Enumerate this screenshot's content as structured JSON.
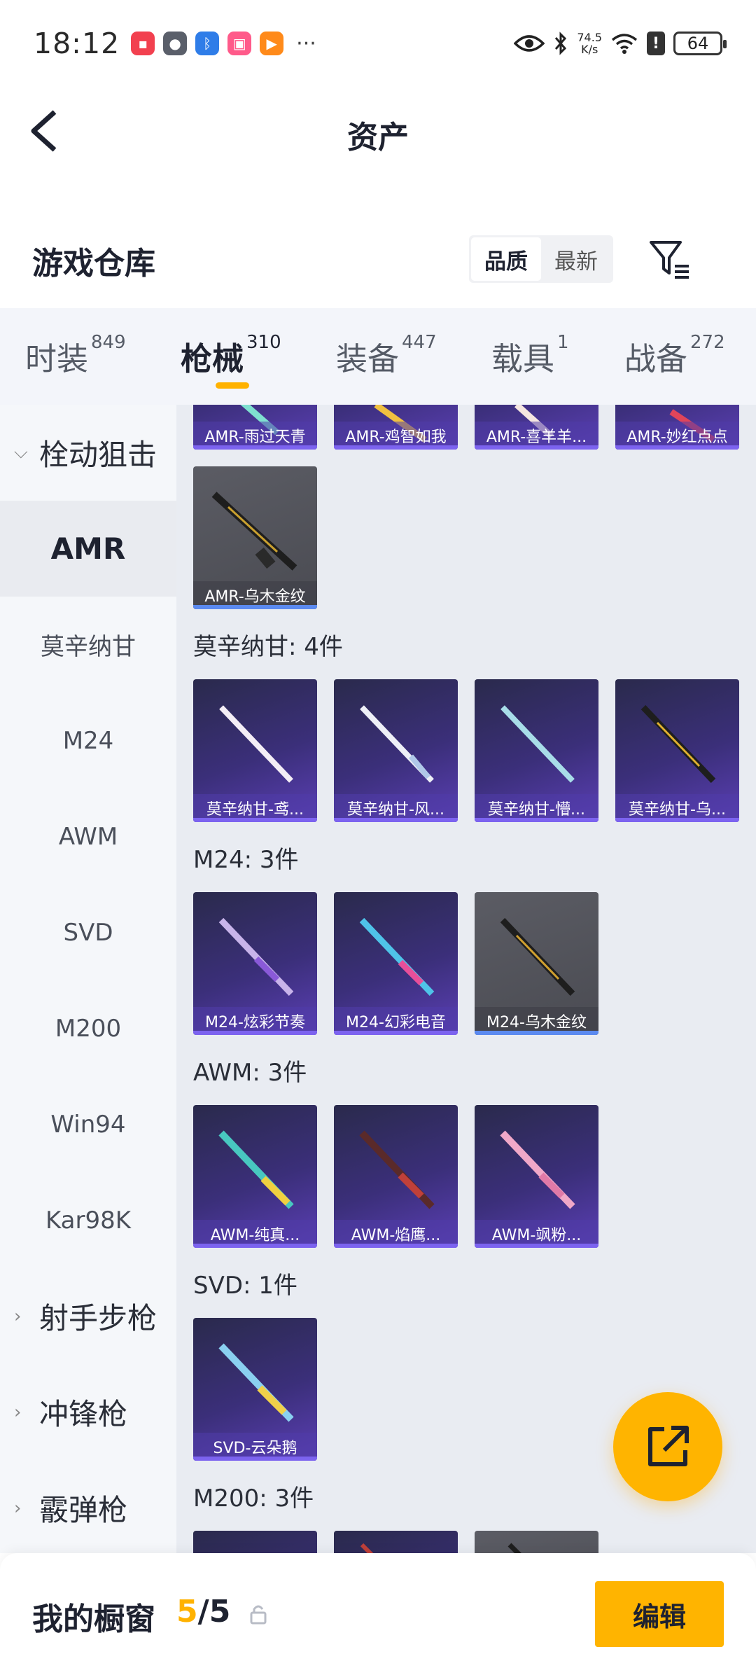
{
  "status_bar": {
    "time": "18:12",
    "net_speed_value": "74.5",
    "net_speed_unit": "K/s",
    "battery": "64"
  },
  "header": {
    "title": "资产"
  },
  "warehouse": {
    "title": "游戏仓库",
    "sort_options": [
      "品质",
      "最新"
    ],
    "sort_selected": "品质"
  },
  "tabs": [
    {
      "label": "时装",
      "count": "849"
    },
    {
      "label": "枪械",
      "count": "310"
    },
    {
      "label": "装备",
      "count": "447"
    },
    {
      "label": "载具",
      "count": "1"
    },
    {
      "label": "战备",
      "count": "272"
    }
  ],
  "active_tab": "枪械",
  "sidebar": {
    "group_bolt": "栓动狙击",
    "selected": "AMR",
    "items": [
      "AMR",
      "莫辛纳甘",
      "M24",
      "AWM",
      "SVD",
      "M200",
      "Win94",
      "Kar98K"
    ],
    "group_marksman": "射手步枪",
    "group_smg": "冲锋枪",
    "group_shotgun": "霰弹枪"
  },
  "amr_partial": [
    "AMR-雨过天青",
    "AMR-鸡智如我",
    "AMR-喜羊羊...",
    "AMR-妙红点点"
  ],
  "amr_last": "AMR-乌木金纹",
  "sections": {
    "mosin": {
      "title": "莫辛纳甘: 4件",
      "items": [
        "莫辛纳甘-鸢...",
        "莫辛纳甘-风...",
        "莫辛纳甘-懵...",
        "莫辛纳甘-乌..."
      ]
    },
    "m24": {
      "title": "M24: 3件",
      "items": [
        "M24-炫彩节奏",
        "M24-幻彩电音",
        "M24-乌木金纹"
      ]
    },
    "awm": {
      "title": "AWM: 3件",
      "items": [
        "AWM-纯真...",
        "AWM-焰鹰...",
        "AWM-飒粉..."
      ]
    },
    "svd": {
      "title": "SVD: 1件",
      "items": [
        "SVD-云朵鹅"
      ]
    },
    "m200": {
      "title": "M200: 3件"
    }
  },
  "bottom": {
    "label": "我的橱窗",
    "count_current": "5",
    "count_sep": "/",
    "count_total": "5",
    "edit_label": "编辑"
  }
}
